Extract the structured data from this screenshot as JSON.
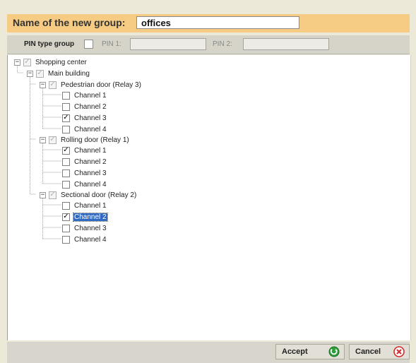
{
  "header": {
    "title": "Name of the new group:",
    "group_name": "offices"
  },
  "pin_bar": {
    "pin_type_label": "PIN type group",
    "pin1_label": "PIN 1:",
    "pin2_label": "PIN 2:",
    "pin1_value": "",
    "pin2_value": ""
  },
  "tree": {
    "root": "Shopping center",
    "building": "Main building",
    "doors": [
      {
        "label": "Pedestrian door (Relay 3)",
        "channels": [
          {
            "label": "Channel 1",
            "checked": false
          },
          {
            "label": "Channel 2",
            "checked": false
          },
          {
            "label": "Channel 3",
            "checked": true
          },
          {
            "label": "Channel 4",
            "checked": false
          }
        ]
      },
      {
        "label": "Rolling door (Relay 1)",
        "channels": [
          {
            "label": "Channel 1",
            "checked": true
          },
          {
            "label": "Channel 2",
            "checked": false
          },
          {
            "label": "Channel 3",
            "checked": false
          },
          {
            "label": "Channel 4",
            "checked": false
          }
        ]
      },
      {
        "label": "Sectional door (Relay 2)",
        "channels": [
          {
            "label": "Channel 1",
            "checked": false
          },
          {
            "label": "Channel 2",
            "checked": true,
            "selected": true
          },
          {
            "label": "Channel 3",
            "checked": false
          },
          {
            "label": "Channel 4",
            "checked": false
          }
        ]
      }
    ]
  },
  "footer": {
    "accept_label": "Accept",
    "cancel_label": "Cancel",
    "accept_icon": "green-ok-icon",
    "cancel_icon": "red-close-icon"
  },
  "colors": {
    "header_bg": "#f6cc84",
    "selection": "#316ac5",
    "accept_green": "#2e9e3a",
    "cancel_red": "#d22b2b"
  }
}
